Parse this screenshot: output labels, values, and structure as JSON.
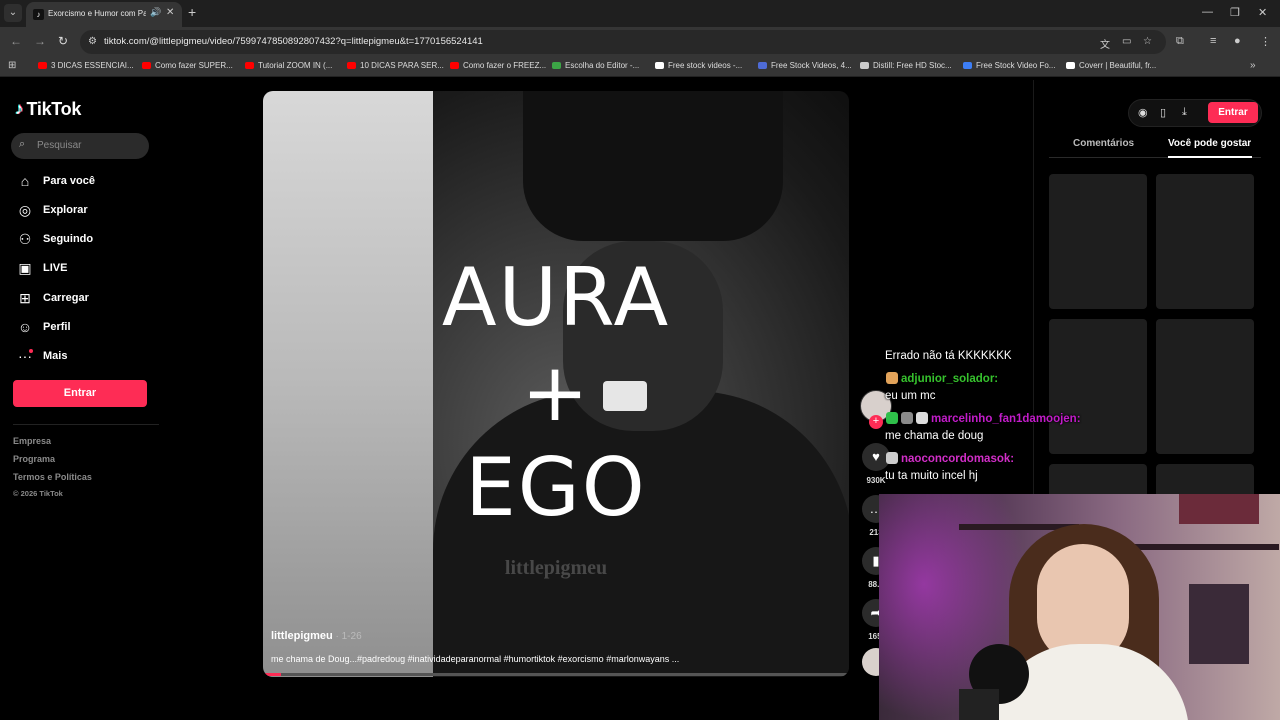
{
  "browser": {
    "tab_title": "Exorcismo e Humor com Pa",
    "url": "tiktok.com/@littlepigmeu/video/7599747850892807432?q=littlepigmeu&t=1770156524141",
    "bookmarks": [
      {
        "label": "3 DICAS ESSENCIAI...",
        "color": "#ff0000"
      },
      {
        "label": "Como fazer SUPER...",
        "color": "#ff0000"
      },
      {
        "label": "Tutorial ZOOM IN (...",
        "color": "#ff0000"
      },
      {
        "label": "10 DICAS PARA SER...",
        "color": "#ff0000"
      },
      {
        "label": "Como fazer o FREEZ...",
        "color": "#ff0000"
      },
      {
        "label": "Escolha do Editor -...",
        "color": "#3ca546"
      },
      {
        "label": "Free stock videos -...",
        "color": "#ffffff"
      },
      {
        "label": "Free Stock Videos, 4...",
        "color": "#4e6bd6"
      },
      {
        "label": "Distill: Free HD Stoc...",
        "color": "#cccccc"
      },
      {
        "label": "Free Stock Video Fo...",
        "color": "#3d7ef5"
      },
      {
        "label": "Coverr | Beautiful, fr...",
        "color": "#ffffff"
      }
    ]
  },
  "sidebar": {
    "logo": "TikTok",
    "search_placeholder": "Pesquisar",
    "items": [
      {
        "label": "Para você",
        "icon": "home-icon"
      },
      {
        "label": "Explorar",
        "icon": "compass-icon"
      },
      {
        "label": "Seguindo",
        "icon": "following-icon"
      },
      {
        "label": "LIVE",
        "icon": "live-icon"
      },
      {
        "label": "Carregar",
        "icon": "upload-icon"
      },
      {
        "label": "Perfil",
        "icon": "profile-icon"
      },
      {
        "label": "Mais",
        "icon": "more-icon"
      }
    ],
    "login_button": "Entrar",
    "footer": [
      "Empresa",
      "Programa",
      "Termos e Políticas"
    ],
    "copyright": "© 2026 TikTok"
  },
  "video": {
    "overlay_line1": "AURA",
    "overlay_line2": "+",
    "overlay_line3": "EGO",
    "watermark": "littlepigmeu",
    "author": "littlepigmeu",
    "date": " · 1-26",
    "description": "me chama de Doug...#padredoug #inatividadeparanormal #humortiktok #exorcismo #marlonwayans ...",
    "progress": 0.03
  },
  "actions": {
    "likes": "930K",
    "comments": "213",
    "saves": "88.7",
    "shares": "165."
  },
  "right_panel": {
    "login_button": "Entrar",
    "tab_comments": "Comentários",
    "tab_you_may_like": "Você pode gostar"
  },
  "chat": [
    {
      "user": "",
      "message": "Errado não tá KKKKKKK",
      "user_color": "#ffffff"
    },
    {
      "user": "adjunior_solador:",
      "message": "eu um mc",
      "user_color": "#36c22d"
    },
    {
      "user": "marcelinho_fan1damoojen:",
      "message": "me chama de doug",
      "user_color": "#c21cc9"
    },
    {
      "user": "naoconcordomasok:",
      "message": "tu ta muito incel hj",
      "user_color": "#d22ec8"
    }
  ],
  "colors": {
    "accent": "#fe2c55",
    "background": "#000000"
  }
}
